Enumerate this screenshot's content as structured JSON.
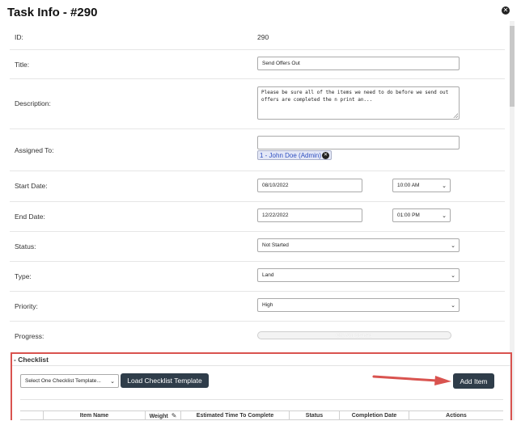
{
  "modal": {
    "title": "Task Info - #290",
    "close_icon": "close-circle-icon"
  },
  "fields": {
    "id": {
      "label": "ID:",
      "value": "290"
    },
    "title": {
      "label": "Title:",
      "value": "Send Offers Out"
    },
    "description": {
      "label": "Description:",
      "value": "Please be sure all of the items we need to do before we send out offers are completed the n print an..."
    },
    "assigned": {
      "label": "Assigned To:",
      "value": "",
      "tag": "1 - John Doe (Admin)",
      "tag_icon": "remove-circle-icon"
    },
    "start": {
      "label": "Start Date:",
      "date": "08/10/2022",
      "time": "10:00 AM"
    },
    "end": {
      "label": "End Date:",
      "date": "12/22/2022",
      "time": "01:00 PM"
    },
    "status": {
      "label": "Status:",
      "value": "Not Started"
    },
    "type": {
      "label": "Type:",
      "value": "Land"
    },
    "priority": {
      "label": "Priority:",
      "value": "High"
    },
    "progress": {
      "label": "Progress:",
      "text": "0% Not Started",
      "percent": 0
    }
  },
  "checklist": {
    "title": "- Checklist",
    "template_select": "Select One Checklist Template...",
    "load_button": "Load Checklist Template",
    "add_button": "Add Item",
    "highlight_color": "#d9534f",
    "columns": [
      "Item Name",
      "Weight",
      "Estimated Time To Complete",
      "Status",
      "Completion Date",
      "Actions"
    ],
    "weight_icon": "pencil-icon"
  },
  "colors": {
    "button_dark": "#2f3d4a",
    "tag_bg": "#e4e8f7",
    "tag_text": "#3050c0",
    "arrow": "#d9534f"
  }
}
